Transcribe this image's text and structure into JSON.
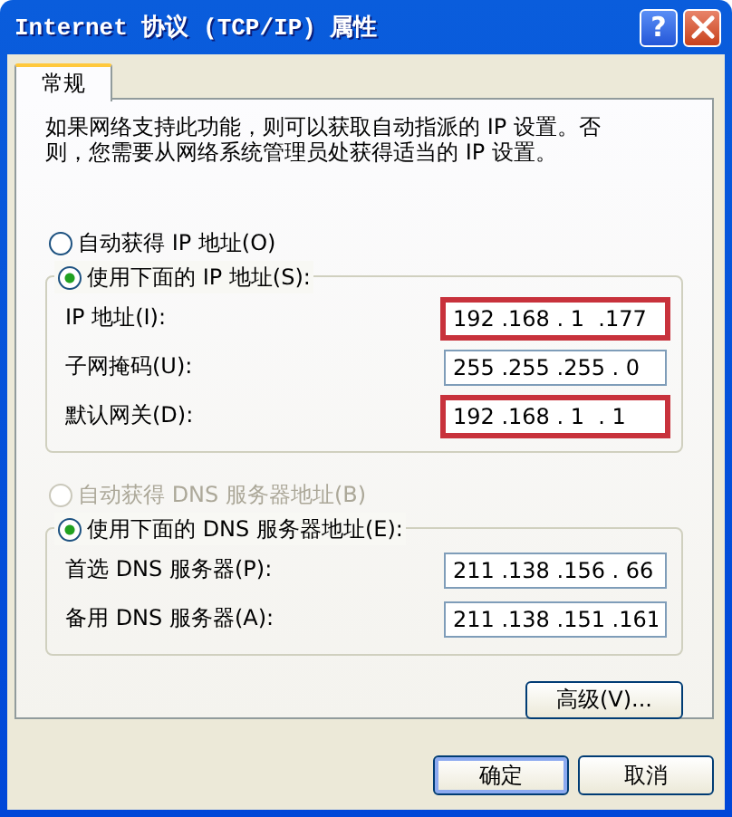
{
  "window": {
    "title": "Internet 协议 (TCP/IP) 属性",
    "help_button": "?"
  },
  "tabs": [
    {
      "label": "常规",
      "selected": true
    }
  ],
  "description": "如果网络支持此功能，则可以获取自动指派的 IP 设置。否则，您需要从网络系统管理员处获得适当的 IP 设置。",
  "ip": {
    "auto_option": {
      "label": "自动获得 IP 地址(O)",
      "selected": false,
      "disabled": false
    },
    "manual_option": {
      "label": "使用下面的 IP 地址(S):",
      "selected": true,
      "disabled": false
    },
    "fields": [
      {
        "label": "IP 地址(I):",
        "value": "192 .168 . 1  .177",
        "highlighted": true
      },
      {
        "label": "子网掩码(U):",
        "value": "255 .255 .255 . 0",
        "highlighted": false
      },
      {
        "label": "默认网关(D):",
        "value": "192 .168 . 1  . 1",
        "highlighted": true
      }
    ]
  },
  "dns": {
    "auto_option": {
      "label": "自动获得 DNS 服务器地址(B)",
      "selected": false,
      "disabled": true
    },
    "manual_option": {
      "label": "使用下面的 DNS 服务器地址(E):",
      "selected": true,
      "disabled": false
    },
    "fields": [
      {
        "label": "首选 DNS 服务器(P):",
        "value": "211 .138 .156 . 66",
        "highlighted": false
      },
      {
        "label": "备用 DNS 服务器(A):",
        "value": "211 .138 .151 .161",
        "highlighted": false
      }
    ]
  },
  "advanced_button": "高级(V)...",
  "buttons": [
    {
      "label": "确定",
      "default": true
    },
    {
      "label": "取消",
      "default": false
    }
  ]
}
